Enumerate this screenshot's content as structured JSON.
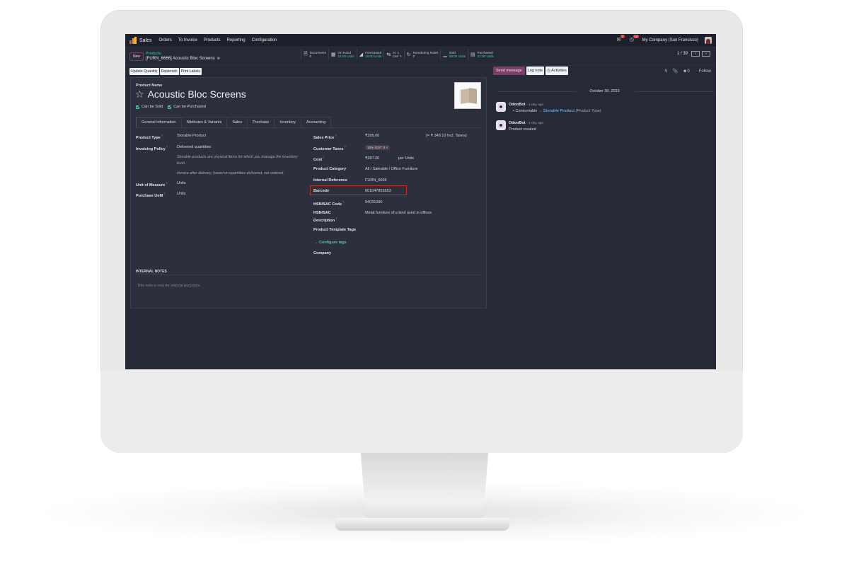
{
  "navbar": {
    "app_name": "Sales",
    "menu": [
      "Orders",
      "To Invoice",
      "Products",
      "Reporting",
      "Configuration"
    ],
    "messages_badge": "7",
    "activities_badge": "14",
    "company": "My Company (San Francisco)"
  },
  "control": {
    "new_label": "New",
    "breadcrumb_parent": "Products",
    "breadcrumb_current": "[FURN_6666] Acoustic Bloc Screens",
    "smart_buttons": [
      {
        "label": "Documents",
        "value": "0",
        "icon": "file-icon"
      },
      {
        "label": "On Hand",
        "value": "16.00 Units",
        "icon": "cubes-icon"
      },
      {
        "label": "Forecasted",
        "value": "16.00 Units",
        "icon": "area-chart-icon"
      },
      {
        "label": "In: 1",
        "value": "Out: 1",
        "icon": "exchange-icon"
      },
      {
        "label": "Reordering Rules",
        "value": "0",
        "icon": "refresh-icon"
      },
      {
        "label": "Sold",
        "value": "48.00 Units",
        "icon": "bar-chart-icon"
      },
      {
        "label": "Purchased",
        "value": "21.00 Units",
        "icon": "credit-card-icon"
      }
    ],
    "pager": "1 / 39"
  },
  "form_actions": [
    "Update Quantity",
    "Replenish",
    "Print Labels"
  ],
  "product": {
    "name_label": "Product Name",
    "name": "Acoustic Bloc Screens",
    "can_be_sold": "Can be Sold",
    "can_be_purchased": "Can be Purchased"
  },
  "tabs": [
    "General Information",
    "Attributes & Variants",
    "Sales",
    "Purchase",
    "Inventory",
    "Accounting"
  ],
  "left_fields": {
    "product_type_label": "Product Type",
    "product_type": "Storable Product",
    "invoicing_policy_label": "Invoicing Policy",
    "invoicing_policy": "Delivered quantities",
    "help_storable": "Storable products are physical items for which you manage the inventory level.",
    "help_invoice": "Invoice after delivery, based on quantities delivered, not ordered.",
    "uom_label": "Unit of Measure",
    "uom": "Units",
    "purchase_uom_label": "Purchase UoM",
    "purchase_uom": "Units"
  },
  "right_fields": {
    "sales_price_label": "Sales Price",
    "sales_price": "₹295.00",
    "sales_price_incl": "(= ₹ 348.10 Incl. Taxes)",
    "customer_taxes_label": "Customer Taxes",
    "customer_tax_tag": "18% IGST S ×",
    "cost_label": "Cost",
    "cost": "₹287.00",
    "cost_unit": "per Units",
    "category_label": "Product Category",
    "category": "All / Saleable / Office Furniture",
    "internal_ref_label": "Internal Reference",
    "internal_ref": "FURN_6666",
    "barcode_label": "Barcode",
    "barcode": "601647855653",
    "hsn_code_label": "HSN/SAC Code",
    "hsn_code": "94031090",
    "hsn_desc_label_1": "HSN/SAC",
    "hsn_desc_label_2": "Description",
    "hsn_desc": "Metal furniture of a kind used in offices",
    "tags_label": "Product Template Tags",
    "configure_tags": "→  Configure tags",
    "company_label": "Company"
  },
  "notes": {
    "title": "INTERNAL NOTES",
    "placeholder": "This note is only for internal purposes."
  },
  "chatter": {
    "send_message": "Send message",
    "log_note": "Log note",
    "activities": "Activities",
    "followers_count": "0",
    "follow": "Follow",
    "date": "October 30, 2023",
    "messages": [
      {
        "author": "OdooBot",
        "time": "- 1 day ago",
        "old": "Consumable",
        "new": "Storable Product",
        "field": "(Product Type)"
      },
      {
        "author": "OdooBot",
        "time": "- 1 day ago",
        "text": "Product created"
      }
    ]
  },
  "colors": {
    "accent_teal": "#4fc3ad",
    "primary_purple": "#7b3e67",
    "background": "#262a36",
    "highlight_red": "#c0322e"
  }
}
